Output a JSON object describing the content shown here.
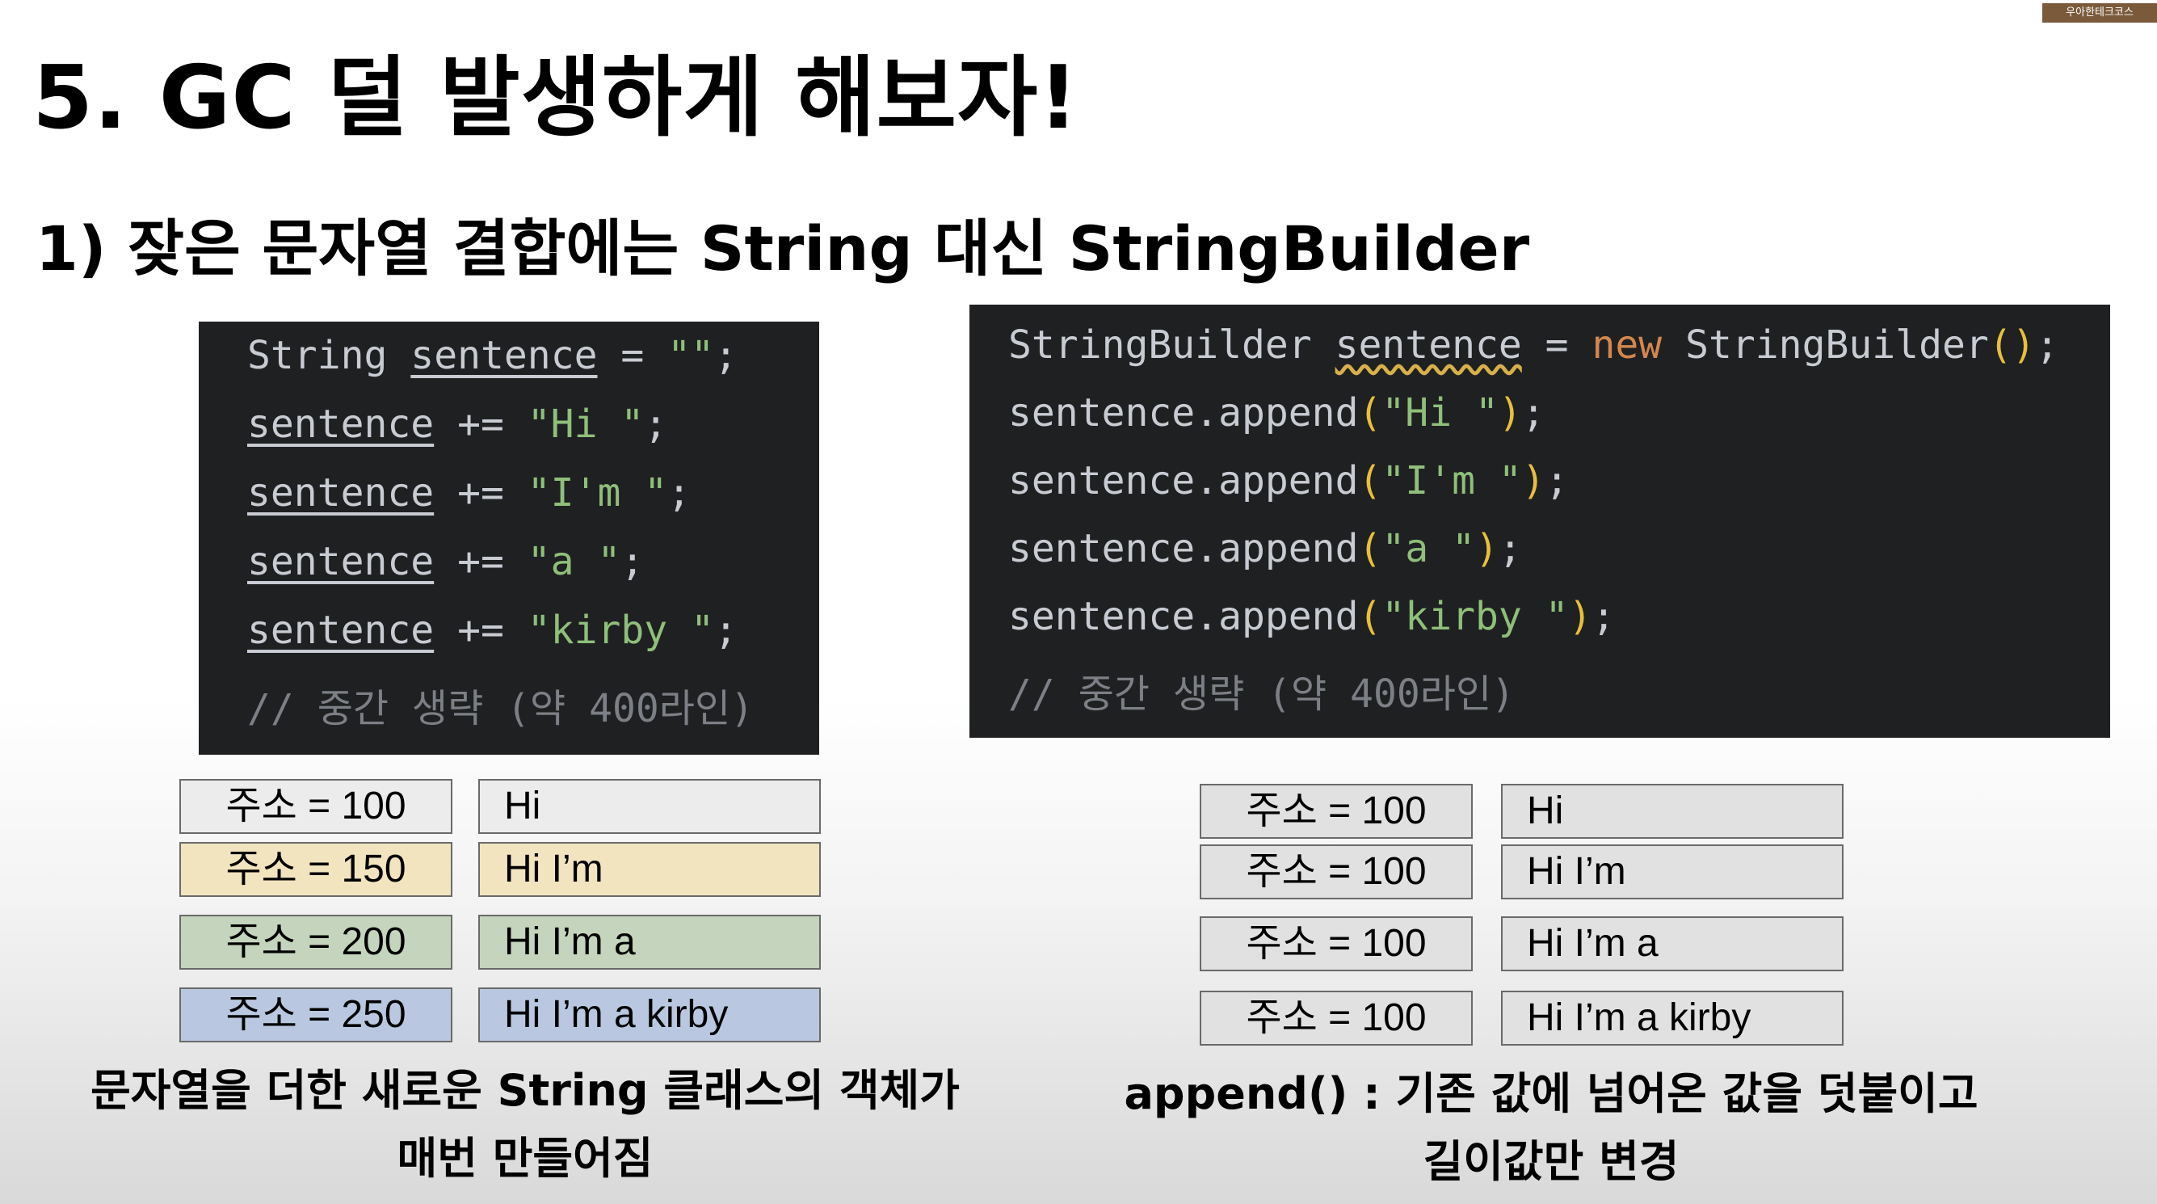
{
  "badge": "우아한테크코스",
  "slide_title": "5. GC 덜 발생하게 해보자!",
  "subtitle": "1) 잦은 문자열 결합에는 String 대신 StringBuilder",
  "left_code": {
    "l1": {
      "type": "String",
      "var": "sentence",
      "eq": " = ",
      "str": "\"\"",
      "end": ";"
    },
    "l2": {
      "var": "sentence",
      "op": " += ",
      "str": "\"Hi \"",
      "end": ";"
    },
    "l3": {
      "var": "sentence",
      "op": " += ",
      "str": "\"I'm \"",
      "end": ";"
    },
    "l4": {
      "var": "sentence",
      "op": " += ",
      "str": "\"a \"",
      "end": ";"
    },
    "l5": {
      "var": "sentence",
      "op": " += ",
      "str": "\"kirby \"",
      "end": ";"
    },
    "l6": {
      "comment": "// 중간 생략 (약 400라인)"
    }
  },
  "right_code": {
    "l1": {
      "type": "StringBuilder",
      "var": "sentence",
      "eq": " = ",
      "kw": "new",
      "cls": " StringBuilder",
      "paren": "()",
      "end": ";"
    },
    "l2": {
      "call": "sentence.append",
      "open": "(",
      "str": "\"Hi \"",
      "close": ")",
      "end": ";"
    },
    "l3": {
      "call": "sentence.append",
      "open": "(",
      "str": "\"I'm \"",
      "close": ")",
      "end": ";"
    },
    "l4": {
      "call": "sentence.append",
      "open": "(",
      "str": "\"a \"",
      "close": ")",
      "end": ";"
    },
    "l5": {
      "call": "sentence.append",
      "open": "(",
      "str": "\"kirby \"",
      "close": ")",
      "end": ";"
    },
    "l6": {
      "comment": "// 중간 생략 (약 400라인)"
    }
  },
  "left_memory": [
    {
      "address": "주소 = 100",
      "value": "Hi",
      "color": "#ececec"
    },
    {
      "address": "주소 = 150",
      "value": "Hi I’m",
      "color": "#f2e4bf"
    },
    {
      "address": "주소 = 200",
      "value": "Hi I’m a",
      "color": "#c5d4bd"
    },
    {
      "address": "주소 = 250",
      "value": "Hi I’m a kirby",
      "color": "#b9c8e0"
    }
  ],
  "right_memory": [
    {
      "address": "주소 = 100",
      "value": "Hi",
      "color": "#e1e1e1"
    },
    {
      "address": "주소 = 100",
      "value": "Hi I’m",
      "color": "#e1e1e1"
    },
    {
      "address": "주소 = 100",
      "value": "Hi I’m a",
      "color": "#e1e1e1"
    },
    {
      "address": "주소 = 100",
      "value": "Hi I’m a kirby",
      "color": "#e1e1e1"
    }
  ],
  "left_caption": {
    "line1": "문자열을 더한 새로운 String 클래스의 객체가",
    "line2": "매번 만들어짐"
  },
  "right_caption": {
    "line1": "append() : 기존 값에 넘어온 값을 덧붙이고",
    "line2": "길이값만 변경"
  }
}
